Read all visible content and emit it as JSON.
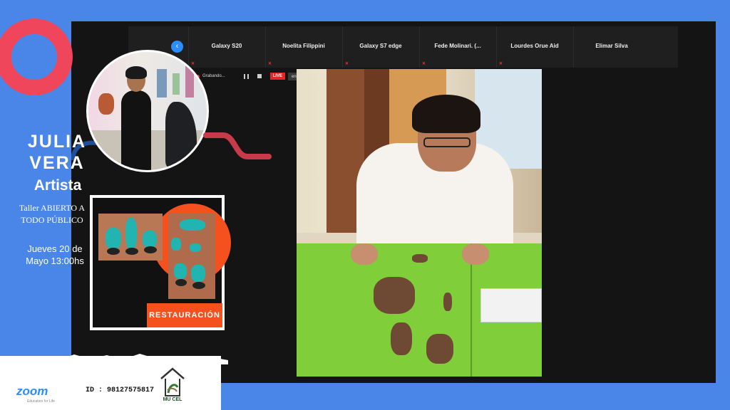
{
  "zoom_window": {
    "nav_arrow": "‹",
    "participants": [
      {
        "name": "Galaxy S20"
      },
      {
        "name": "Noelita Filippini"
      },
      {
        "name": "Galaxy S7 edge"
      },
      {
        "name": "Fede Molinari. (..."
      },
      {
        "name": "Lourdes Orue Aid"
      },
      {
        "name": "Elimar Silva"
      }
    ],
    "recording": {
      "label": "Grabando...",
      "live_label": "LIVE",
      "live_target": "en Facebook"
    }
  },
  "flyer": {
    "artist_name": "JULIA\nVERA",
    "artist_role": "Artista",
    "taller": "Taller ABIERTO A TODO PÚBLICO",
    "fecha": "Jueves 20 de Mayo 13:00hs",
    "restauracion_label": "RESTAURACIÓN"
  },
  "footer": {
    "zoom_logo": "zoom",
    "zoom_tagline": "Education for Life",
    "meeting_id": "ID : 98127575817",
    "mucel_text": "MU CEL"
  },
  "colors": {
    "background": "#4a86e8",
    "accent_red": "#f0465b",
    "accent_orange": "#f4511e",
    "zoom_blue": "#2d8cff",
    "live_red": "#e02828"
  }
}
